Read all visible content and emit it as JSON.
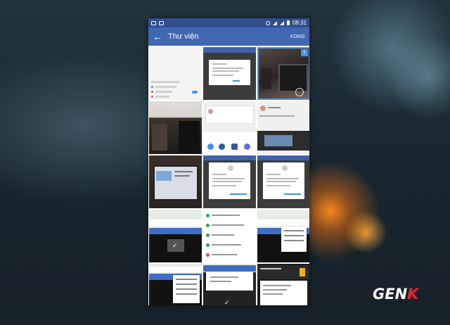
{
  "statusbar": {
    "time": "08:31"
  },
  "appbar": {
    "back_glyph": "←",
    "title": "Thư viện",
    "done_label": "XONG"
  },
  "selection": {
    "count": "1"
  },
  "watermark": {
    "text_main": "GEN",
    "text_accent": "K"
  },
  "colors": {
    "appbar": "#4267b2",
    "statusbar": "#304f8f",
    "selection": "#4a90e2",
    "logo_accent": "#e8282e"
  },
  "tiles": [
    "settings-screenshot",
    "dialog-screenshot",
    "desk-photo-selected",
    "desk-photo",
    "facebook-share-screenshot",
    "facebook-post-screenshot",
    "laptop-photo",
    "permission-dialog-screenshot",
    "permission-dialog-screenshot",
    "map-screenshot",
    "list-screenshot",
    "map-menu-screenshot",
    "map-menu-screenshot",
    "map-dialog-screenshot",
    "notification-screenshot"
  ]
}
